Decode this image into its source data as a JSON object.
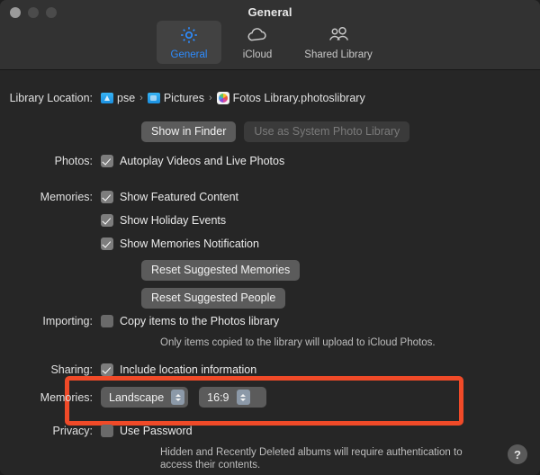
{
  "window": {
    "title": "General",
    "traffic_lights": [
      "close-button",
      "minimize-button",
      "zoom-button"
    ]
  },
  "toolbar": {
    "tabs": [
      {
        "label": "General",
        "icon": "gear-icon",
        "selected": true
      },
      {
        "label": "iCloud",
        "icon": "cloud-icon",
        "selected": false
      },
      {
        "label": "Shared Library",
        "icon": "people-icon",
        "selected": false
      }
    ]
  },
  "library_location": {
    "label": "Library Location:",
    "path": [
      {
        "name": "pse",
        "icon": "home-folder-icon"
      },
      {
        "name": "Pictures",
        "icon": "folder-icon"
      },
      {
        "name": "Fotos Library.photoslibrary",
        "icon": "photos-library-icon"
      }
    ],
    "separator": "›",
    "buttons": {
      "show_in_finder": "Show in Finder",
      "use_as_system": "Use as System Photo Library"
    }
  },
  "photos": {
    "label": "Photos:",
    "autoplay": {
      "text": "Autoplay Videos and Live Photos",
      "checked": true
    }
  },
  "memories": {
    "label": "Memories:",
    "featured": {
      "text": "Show Featured Content",
      "checked": true
    },
    "holiday": {
      "text": "Show Holiday Events",
      "checked": true
    },
    "notification": {
      "text": "Show Memories Notification",
      "checked": true
    },
    "reset_memories": "Reset Suggested Memories",
    "reset_people": "Reset Suggested People"
  },
  "importing": {
    "label": "Importing:",
    "copy_items": {
      "text": "Copy items to the Photos library",
      "checked": false
    },
    "note": "Only items copied to the library will upload to iCloud Photos.",
    "highlight_color": "#f04a28"
  },
  "sharing": {
    "label": "Sharing:",
    "include_location": {
      "text": "Include location information",
      "checked": true
    },
    "memories_label": "Memories:",
    "orientation_value": "Landscape",
    "aspect_value": "16:9"
  },
  "privacy": {
    "label": "Privacy:",
    "use_password": {
      "text": "Use Password",
      "checked": false
    },
    "note_line1": "Hidden and Recently Deleted albums will require authentication to",
    "note_line2": "access their contents."
  },
  "help_button": "?"
}
